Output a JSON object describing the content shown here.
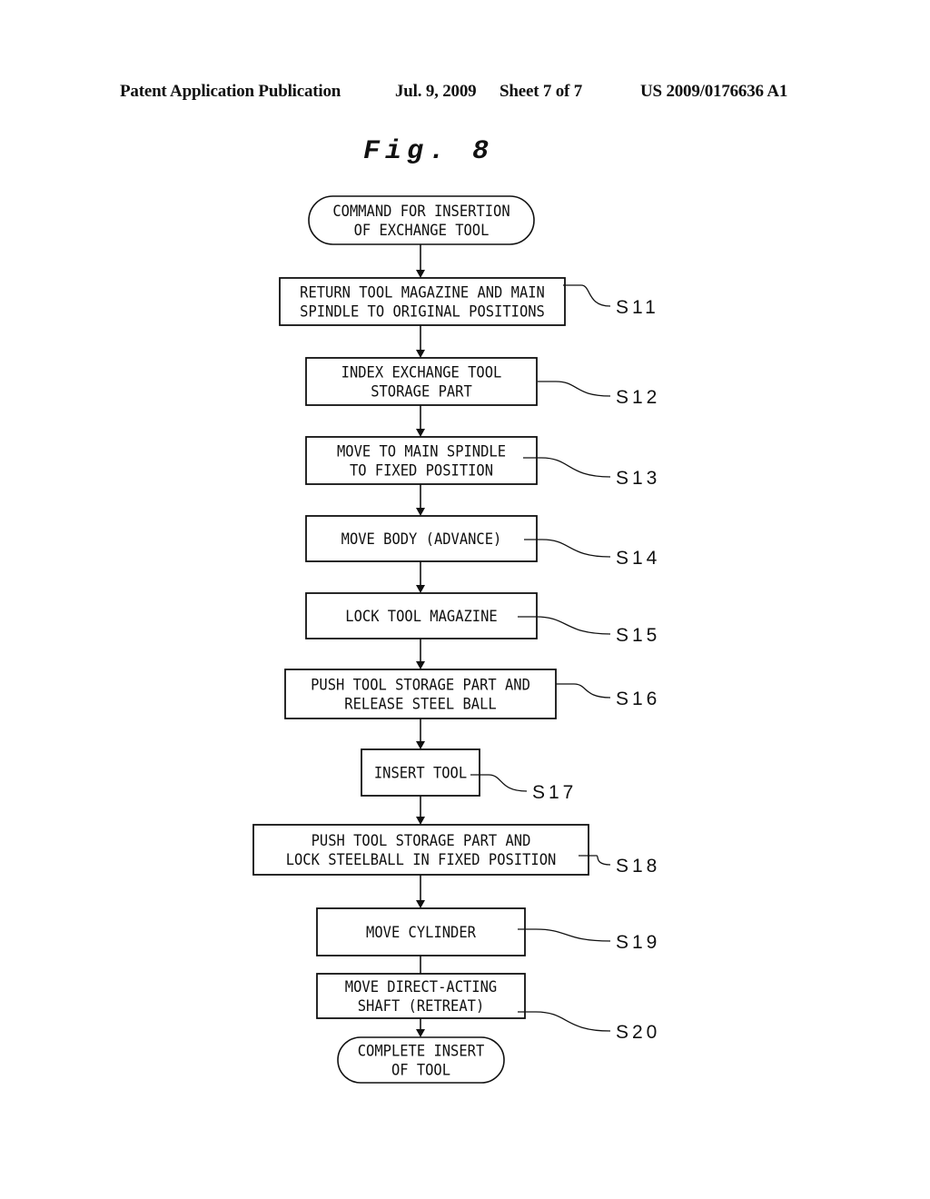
{
  "header": {
    "publication": "Patent Application Publication",
    "date": "Jul. 9, 2009",
    "sheet": "Sheet 7 of 7",
    "number": "US 2009/0176636 A1"
  },
  "figure": {
    "title": "Fig. 8"
  },
  "flowchart": {
    "nodes": [
      {
        "id": "start",
        "type": "terminal",
        "lines": [
          "COMMAND FOR INSERTION",
          "OF EXCHANGE TOOL"
        ],
        "label": ""
      },
      {
        "id": "s11",
        "type": "process",
        "lines": [
          "RETURN TOOL MAGAZINE AND MAIN",
          "SPINDLE TO ORIGINAL POSITIONS"
        ],
        "label": "S11"
      },
      {
        "id": "s12",
        "type": "process",
        "lines": [
          "INDEX EXCHANGE TOOL",
          "STORAGE PART"
        ],
        "label": "S12"
      },
      {
        "id": "s13",
        "type": "process",
        "lines": [
          "MOVE TO MAIN SPINDLE",
          "TO FIXED POSITION"
        ],
        "label": "S13"
      },
      {
        "id": "s14",
        "type": "process",
        "lines": [
          "MOVE BODY (ADVANCE)"
        ],
        "label": "S14"
      },
      {
        "id": "s15",
        "type": "process",
        "lines": [
          "LOCK TOOL MAGAZINE"
        ],
        "label": "S15"
      },
      {
        "id": "s16",
        "type": "process",
        "lines": [
          "PUSH TOOL STORAGE PART AND",
          "RELEASE STEEL BALL"
        ],
        "label": "S16"
      },
      {
        "id": "s17",
        "type": "process",
        "lines": [
          "INSERT TOOL"
        ],
        "label": "S17"
      },
      {
        "id": "s18",
        "type": "process",
        "lines": [
          "PUSH TOOL STORAGE PART AND",
          "LOCK STEELBALL IN FIXED POSITION"
        ],
        "label": "S18"
      },
      {
        "id": "s19",
        "type": "process",
        "lines": [
          "MOVE CYLINDER"
        ],
        "label": "S19"
      },
      {
        "id": "s20",
        "type": "process",
        "lines": [
          "MOVE DIRECT-ACTING",
          "SHAFT (RETREAT)"
        ],
        "label": "S20"
      },
      {
        "id": "end",
        "type": "terminal",
        "lines": [
          "COMPLETE INSERT",
          "OF TOOL"
        ],
        "label": ""
      }
    ],
    "edges": [
      {
        "from": "start",
        "to": "s11",
        "arrow": true
      },
      {
        "from": "s11",
        "to": "s12",
        "arrow": true
      },
      {
        "from": "s12",
        "to": "s13",
        "arrow": true
      },
      {
        "from": "s13",
        "to": "s14",
        "arrow": true
      },
      {
        "from": "s14",
        "to": "s15",
        "arrow": true
      },
      {
        "from": "s15",
        "to": "s16",
        "arrow": true
      },
      {
        "from": "s16",
        "to": "s17",
        "arrow": true
      },
      {
        "from": "s17",
        "to": "s18",
        "arrow": true
      },
      {
        "from": "s18",
        "to": "s19",
        "arrow": true
      },
      {
        "from": "s19",
        "to": "s20",
        "arrow": false
      },
      {
        "from": "s20",
        "to": "end",
        "arrow": true
      }
    ]
  }
}
